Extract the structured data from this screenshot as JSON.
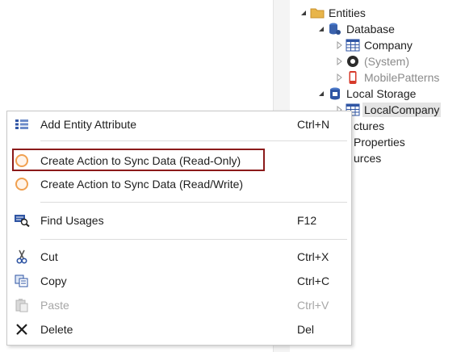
{
  "tree": {
    "nodes": [
      {
        "label": "Entities",
        "icon": "folder-icon"
      },
      {
        "label": "Database",
        "icon": "database-icon"
      },
      {
        "label": "Company",
        "icon": "entity-table-icon"
      },
      {
        "label": "(System)",
        "icon": "system-module-icon"
      },
      {
        "label": "MobilePatterns",
        "icon": "mobile-module-icon"
      },
      {
        "label": "Local Storage",
        "icon": "local-storage-icon"
      },
      {
        "label": "LocalCompany",
        "icon": "entity-table-icon"
      }
    ],
    "partial_labels": [
      "ctures",
      "Properties",
      "urces"
    ]
  },
  "context_menu": {
    "items": [
      {
        "label": "Add Entity Attribute",
        "shortcut": "Ctrl+N",
        "icon": "add-attribute-icon",
        "enabled": true
      },
      {
        "label": "Create Action to Sync Data (Read-Only)",
        "shortcut": "",
        "icon": "orange-circle-icon",
        "enabled": true
      },
      {
        "label": "Create Action to Sync Data (Read/Write)",
        "shortcut": "",
        "icon": "orange-circle-icon",
        "enabled": true
      },
      {
        "label": "Find Usages",
        "shortcut": "F12",
        "icon": "find-usages-icon",
        "enabled": true
      },
      {
        "label": "Cut",
        "shortcut": "Ctrl+X",
        "icon": "scissors-icon",
        "enabled": true
      },
      {
        "label": "Copy",
        "shortcut": "Ctrl+C",
        "icon": "copy-icon",
        "enabled": true
      },
      {
        "label": "Paste",
        "shortcut": "Ctrl+V",
        "icon": "paste-icon",
        "enabled": false
      },
      {
        "label": "Delete",
        "shortcut": "Del",
        "icon": "delete-x-icon",
        "enabled": true
      }
    ],
    "highlighted_item": "Create Action to Sync Data (Read-Only)"
  },
  "colors": {
    "highlight_border": "#8b1a1a",
    "sync_icon": "#f0a050",
    "folder": "#e8b54a",
    "entity_icon": "#2f55a4"
  }
}
